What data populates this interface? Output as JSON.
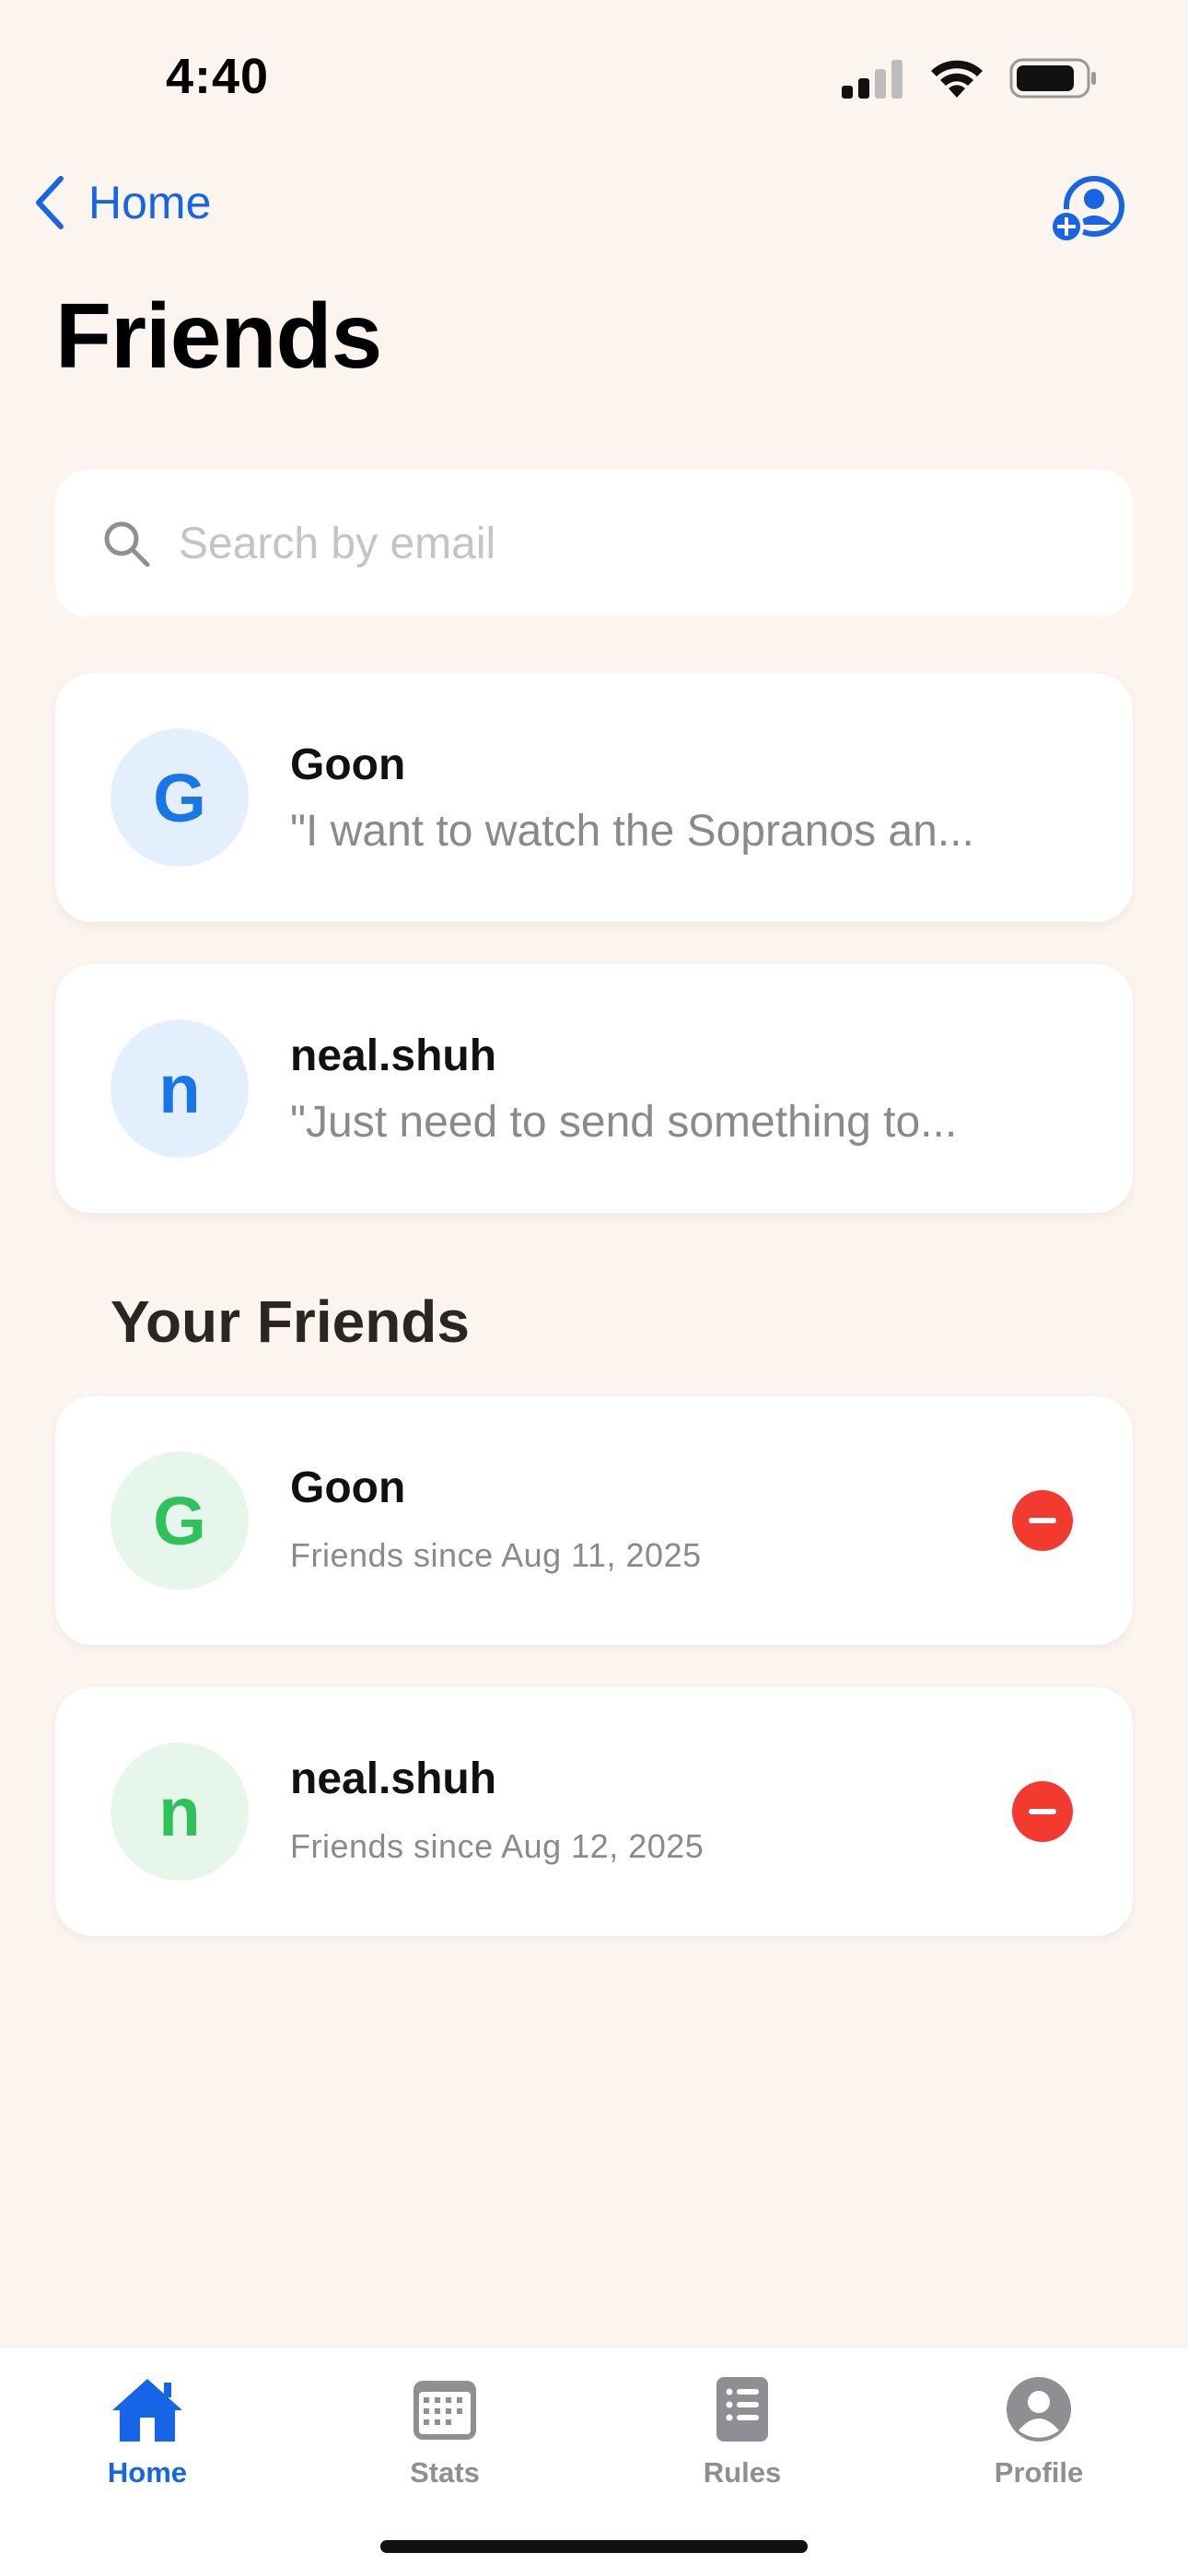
{
  "status_bar": {
    "time": "4:40"
  },
  "nav": {
    "back_label": "Home",
    "title": "Friends"
  },
  "search": {
    "placeholder": "Search by email"
  },
  "requests": [
    {
      "initial": "G",
      "name": "Goon",
      "preview": "\"I want to watch the Sopranos an..."
    },
    {
      "initial": "n",
      "name": "neal.shuh",
      "preview": "\"Just need to send something to..."
    }
  ],
  "friends_section": {
    "title": "Your Friends"
  },
  "friends": [
    {
      "initial": "G",
      "name": "Goon",
      "since": "Friends since Aug 11, 2025"
    },
    {
      "initial": "n",
      "name": "neal.shuh",
      "since": "Friends since Aug 12, 2025"
    }
  ],
  "tabs": [
    {
      "label": "Home",
      "icon": "house-icon",
      "active": true
    },
    {
      "label": "Stats",
      "icon": "calendar-icon",
      "active": false
    },
    {
      "label": "Rules",
      "icon": "list-icon",
      "active": false
    },
    {
      "label": "Profile",
      "icon": "person-circle-icon",
      "active": false
    }
  ],
  "colors": {
    "background": "#FBF4EF",
    "accent": "#1565E6",
    "request_avatar_bg": "#E4EFFD",
    "friend_avatar_bg": "#E6F6EA",
    "friend_avatar_fg": "#2DC35A",
    "remove": "#F23A2F"
  }
}
